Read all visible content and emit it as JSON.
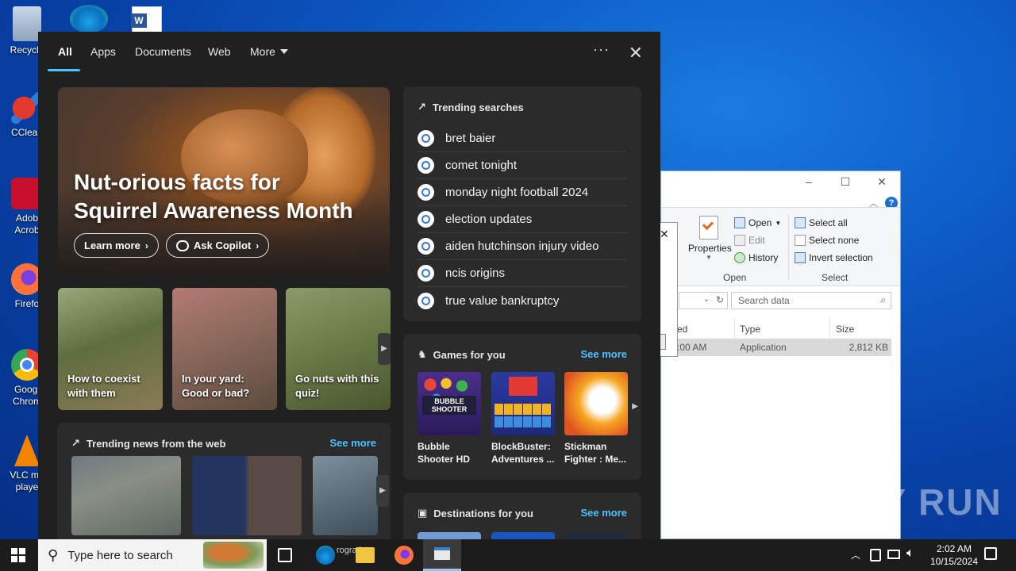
{
  "desktop": {
    "icons": [
      {
        "label": "Recycle"
      },
      {
        "label": "CClean"
      },
      {
        "label": "Adob\nAcrob"
      },
      {
        "label": "Firefo"
      },
      {
        "label": "Googl\nChrom"
      },
      {
        "label": "VLC me\nplaye"
      }
    ]
  },
  "explorer": {
    "ribbon": {
      "properties_label": "Properties",
      "open_label": "Open",
      "edit_label": "Edit",
      "history_label": "History",
      "open_group": "Open",
      "select_all": "Select all",
      "select_none": "Select none",
      "invert_selection": "Invert selection",
      "select_group": "Select"
    },
    "search_placeholder": "Search data",
    "columns": {
      "col1": "ed",
      "type": "Type",
      "size": "Size"
    },
    "file": {
      "time": ":00 AM",
      "type": "Application",
      "size": "2,812 KB"
    }
  },
  "watermark": "ANY RUN",
  "search": {
    "tabs": [
      {
        "label": "All"
      },
      {
        "label": "Apps"
      },
      {
        "label": "Documents"
      },
      {
        "label": "Web"
      },
      {
        "label": "More"
      }
    ],
    "hero": {
      "title_line1": "Nut-orious facts for",
      "title_line2": "Squirrel Awareness Month",
      "learn_more": "Learn more",
      "ask_copilot": "Ask Copilot"
    },
    "cards": [
      {
        "line1": "How to coexist",
        "line2": "with them"
      },
      {
        "line1": "In your yard:",
        "line2": "Good or bad?"
      },
      {
        "line1": "Go nuts with this",
        "line2": "quiz!"
      }
    ],
    "trending_news": {
      "title": "Trending news from the web",
      "see_more": "See more"
    },
    "trending_searches": {
      "title": "Trending searches",
      "items": [
        "bret baier",
        "comet tonight",
        "monday night football 2024",
        "election updates",
        "aiden hutchinson injury video",
        "ncis origins",
        "true value bankruptcy"
      ]
    },
    "games": {
      "title": "Games for you",
      "see_more": "See more",
      "items": [
        {
          "line1": "Bubble",
          "line2": "Shooter HD",
          "art": "BUBBLE SHOOTER"
        },
        {
          "line1": "BlockBuster:",
          "line2": "Adventures ..."
        },
        {
          "line1": "Stickman",
          "line2": "Fighter : Me..."
        }
      ]
    },
    "destinations": {
      "title": "Destinations for you",
      "see_more": "See more"
    }
  },
  "taskbar": {
    "search_placeholder": "Type here to search",
    "time": "2:02 AM",
    "date": "10/15/2024",
    "partial_label": "rogra ista"
  },
  "colors": {
    "accent": "#4cc2ff",
    "flyout_bg": "#202020",
    "panel_bg": "#2b2b2b"
  }
}
